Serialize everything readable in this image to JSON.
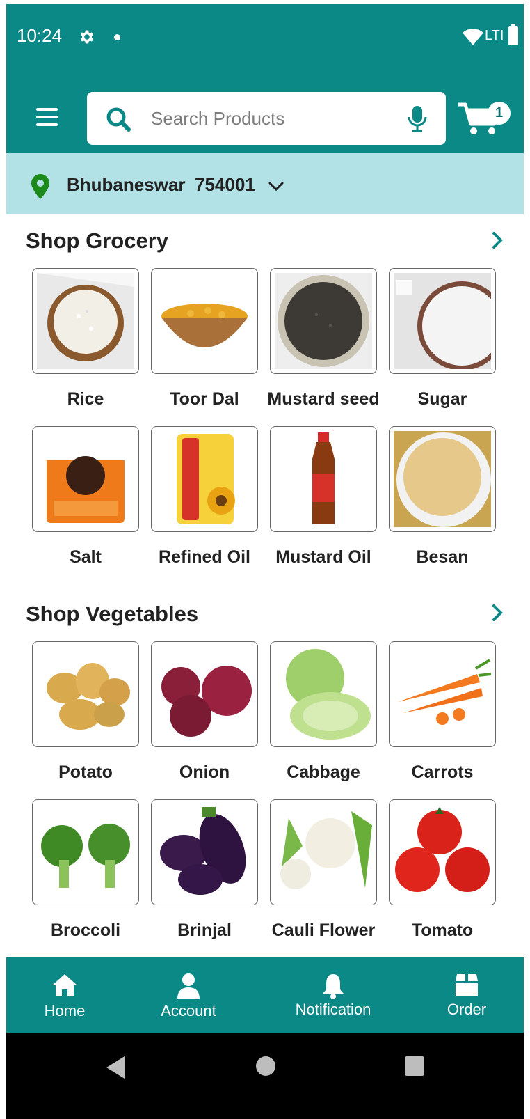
{
  "status_bar": {
    "time": "10:24",
    "network": "LTE",
    "network_display": "LTI"
  },
  "header": {
    "search_placeholder": "Search Products",
    "cart_count": "1"
  },
  "location": {
    "city": "Bhubaneswar",
    "pincode": "754001"
  },
  "sections": [
    {
      "title": "Shop Grocery",
      "items": [
        {
          "label": "Rice"
        },
        {
          "label": "Toor Dal"
        },
        {
          "label": "Mustard seed"
        },
        {
          "label": "Sugar"
        },
        {
          "label": "Salt"
        },
        {
          "label": "Refined Oil"
        },
        {
          "label": "Mustard Oil"
        },
        {
          "label": "Besan"
        }
      ]
    },
    {
      "title": "Shop Vegetables",
      "items": [
        {
          "label": "Potato"
        },
        {
          "label": "Onion"
        },
        {
          "label": "Cabbage"
        },
        {
          "label": "Carrots"
        },
        {
          "label": "Broccoli"
        },
        {
          "label": "Brinjal"
        },
        {
          "label": "Cauli Flower"
        },
        {
          "label": "Tomato"
        }
      ]
    }
  ],
  "bottom_nav": [
    {
      "label": "Home",
      "icon": "home-icon"
    },
    {
      "label": "Account",
      "icon": "account-icon"
    },
    {
      "label": "Notification",
      "icon": "bell-icon"
    },
    {
      "label": "Order",
      "icon": "box-icon"
    }
  ],
  "colors": {
    "primary": "#0b8987",
    "location_bar": "#b2e1e6",
    "pin": "#1b8a1b"
  }
}
